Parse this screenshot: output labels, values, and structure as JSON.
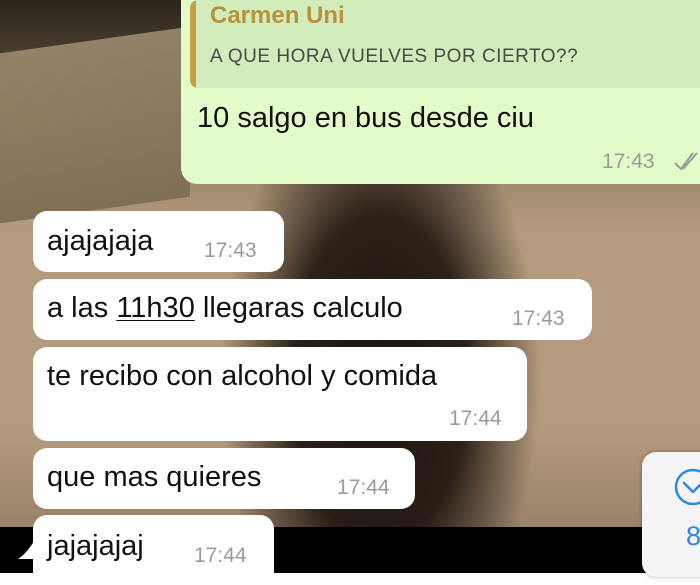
{
  "colors": {
    "outgoing_bubble": "#e3fbc9",
    "incoming_bubble": "#ffffff",
    "quote_accent": "#c99f45",
    "read_ticks": "#9a9a9a",
    "scroll_accent": "#2d87e6"
  },
  "outgoing": {
    "quote_author": "Carmen Uni",
    "quote_text": "A QUE HORA VUELVES POR CIERTO??",
    "text": "10 salgo en bus desde ciu",
    "time": "17:43",
    "status_icon": "double-check-read-icon"
  },
  "incoming": [
    {
      "text": "ajajajaja",
      "time": "17:43"
    },
    {
      "text_before": "a las ",
      "text_link": "11h30",
      "text_after": " llegaras calculo",
      "time": "17:43"
    },
    {
      "text": "te recibo con alcohol y comida",
      "time": "17:44"
    },
    {
      "text": "que mas quieres",
      "time": "17:44"
    },
    {
      "text": "jajajajaj",
      "time": "17:44"
    }
  ],
  "scroll_button": {
    "icon": "chevron-down-circle-icon",
    "count": "8"
  }
}
